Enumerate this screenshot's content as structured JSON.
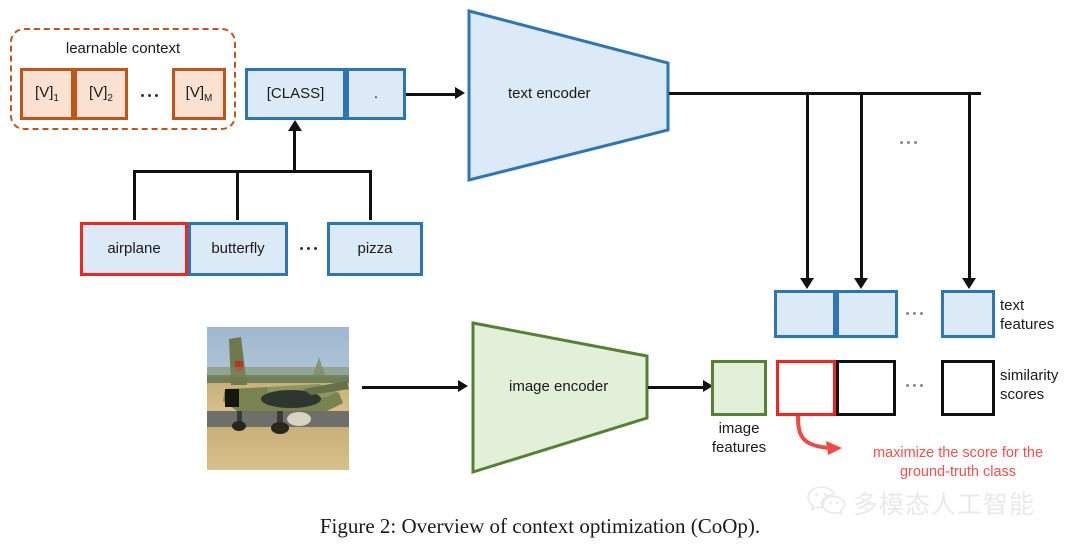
{
  "figure": {
    "caption": "Figure 2: Overview of context optimization (CoOp).",
    "watermark_text": "多模态人工智能",
    "watermark_icon": "wechat-icon"
  },
  "colors": {
    "orange_border": "#c0551a",
    "orange_fill": "#fbe1d1",
    "blue_border": "#2e75b6",
    "blue_fill": "#dce9f7",
    "green_border": "#548235",
    "green_fill": "#e2efd9",
    "red": "#f3261f",
    "red_text": "#f4514b",
    "black": "#111111"
  },
  "learnable_context": {
    "title": "learnable context",
    "tokens": [
      {
        "base": "[V]",
        "sub": "1"
      },
      {
        "base": "[V]",
        "sub": "2"
      },
      {
        "base": "[V]",
        "sub": "M"
      }
    ],
    "ellipsis": "···"
  },
  "prompt": {
    "class_token": "[CLASS]",
    "period_token": "."
  },
  "class_names": [
    {
      "label": "airplane",
      "highlight": true
    },
    {
      "label": "butterfly",
      "highlight": false
    },
    {
      "label": "pizza",
      "highlight": false
    }
  ],
  "encoders": {
    "text": "text encoder",
    "image": "image encoder"
  },
  "image_features": {
    "label_line1": "image",
    "label_line2": "features"
  },
  "text_features": {
    "label_line1": "text",
    "label_line2": "features",
    "count_visible": 3
  },
  "similarity_scores": {
    "label_line1": "similarity",
    "label_line2": "scores",
    "count_visible": 3,
    "highlight_index": 0
  },
  "annotation": {
    "line1": "maximize the score for the",
    "line2": "ground-truth class"
  },
  "photo": {
    "alt": "military jet airplane on runway"
  }
}
